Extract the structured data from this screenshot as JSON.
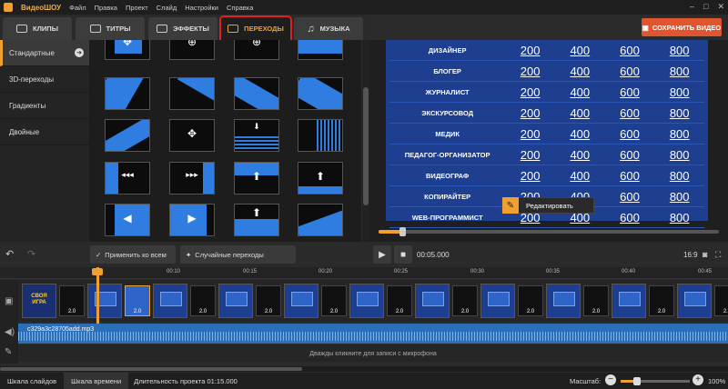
{
  "titlebar": {
    "app_name": "ВидеоШОУ",
    "menu": [
      "Файл",
      "Правка",
      "Проект",
      "Слайд",
      "Настройки",
      "Справка"
    ]
  },
  "tabs": [
    {
      "label": "КЛИПЫ"
    },
    {
      "label": "ТИТРЫ"
    },
    {
      "label": "ЭФФЕКТЫ"
    },
    {
      "label": "ПЕРЕХОДЫ",
      "active": true
    },
    {
      "label": "МУЗЫКА"
    }
  ],
  "save_button": "СОХРАНИТЬ ВИДЕО",
  "sidebar": {
    "items": [
      {
        "label": "Стандартные",
        "active": true
      },
      {
        "label": "3D-переходы"
      },
      {
        "label": "Градиенты"
      },
      {
        "label": "Двойные"
      }
    ]
  },
  "quiz": {
    "values": [
      "200",
      "400",
      "600",
      "800"
    ],
    "rows": [
      {
        "category": "ДИЗАЙНЕР"
      },
      {
        "category": "БЛОГЕР"
      },
      {
        "category": "ЖУРНАЛИСТ"
      },
      {
        "category": "ЭКСКУРСОВОД"
      },
      {
        "category": "МЕДИК"
      },
      {
        "category": "ПЕДАГОГ-ОРГАНИЗАТОР"
      },
      {
        "category": "ВИДЕОГРАФ"
      },
      {
        "category": "КОПИРАЙТЕР"
      },
      {
        "category": "WEB-ПРОГРАММИСТ"
      }
    ]
  },
  "edit_popup": {
    "label": "Редактировать"
  },
  "playback": {
    "time": "00:05.000",
    "aspect": "16:9",
    "progress": 0.07
  },
  "controls": {
    "apply_all": "Применить ко всем",
    "random_transitions": "Случайные переходы"
  },
  "ruler": {
    "ticks": [
      "00:10",
      "00:15",
      "00:20",
      "00:25",
      "00:30",
      "00:35",
      "00:40",
      "00:45"
    ]
  },
  "timeline": {
    "transition_label": "2.0",
    "audio_file": "c329a3c28705add.mp3",
    "mic_hint": "Дважды кликните для записи с микрофона",
    "first_slide_text": "СВОЯ ИГРА"
  },
  "status": {
    "tab_slides": "Шкала слайдов",
    "tab_timeline": "Шкала времени",
    "duration": "Длительность проекта 01:15.000",
    "zoom_label": "Масштаб:",
    "zoom_value": "100%"
  }
}
